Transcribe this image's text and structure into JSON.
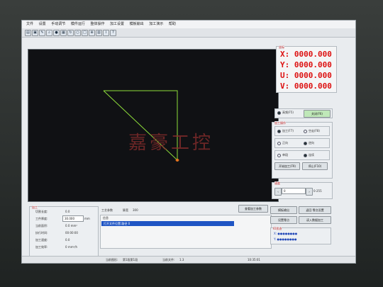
{
  "menu": [
    "文件",
    "设置",
    "手动调节",
    "模件运行",
    "整体操作",
    "加工设置",
    "模板输出",
    "加工演示",
    "帮助"
  ],
  "toolbar_icons": [
    "open-icon",
    "save-icon",
    "tool-icon",
    "search-icon",
    "pin-icon",
    "grid-icon",
    "rotate-icon",
    "circle-icon",
    "square-icon",
    "zoom-icon",
    "table-icon",
    "info-icon",
    "help-icon"
  ],
  "coords": {
    "title": "坐标",
    "x_label": "X:",
    "x_value": "0000.000",
    "y_label": "Y:",
    "y_value": "0000.000",
    "u_label": "U:",
    "u_value": "0000.000",
    "v_label": "V:",
    "v_value": "0000.000"
  },
  "mode": {
    "opt1": "高频(F5)",
    "opt2": "关闭(F6)"
  },
  "machining": {
    "title": "加工操作",
    "radio_a1": "加工(F7)",
    "radio_a2": "空走(F8)",
    "radio_b1": "正向",
    "radio_b2": "逆向",
    "radio_c1": "单段",
    "radio_c2": "连续",
    "start_btn": "开始加工(F9)",
    "stop_btn": "停止(F10)"
  },
  "speed": {
    "title": "速度",
    "value": "0",
    "unit": "0-255"
  },
  "left_panel": {
    "title": "加工",
    "rows": [
      {
        "label": "切割长度:",
        "value": "0.0"
      },
      {
        "label": "工件厚度:",
        "value": "30.000",
        "unit": "mm"
      },
      {
        "label": "当前面积:",
        "value": "0.0 mm²"
      },
      {
        "label": "执行时间:",
        "value": "00:00:00"
      },
      {
        "label": "加工速度:",
        "value": "0.0"
      },
      {
        "label": "加工效率:",
        "value": "0 mm²/h"
      }
    ]
  },
  "params": {
    "label1": "工艺参数",
    "label2": "脉宽",
    "value2": "300",
    "btn": "查看加工参数"
  },
  "log": {
    "title": "信息",
    "line": "打开文件位置:路径 0"
  },
  "right_buttons": [
    "模板输出",
    "返回 零点设置",
    "设置零点",
    "读入数据加工"
  ],
  "status": {
    "label1": "当前图形:",
    "value1": "第1段第1段",
    "label2": "当前文件:",
    "value2": "1.3",
    "time": "10:35:01"
  },
  "dots_title": "IO状态",
  "dots_rows": [
    "X: ●●●●●●●●",
    "Y: ●●●●●●●●"
  ],
  "colors": {
    "trace": "#8ede3a",
    "point": "#e8761e",
    "coord_text": "#dd1111"
  },
  "watermark": "嘉豪工控"
}
